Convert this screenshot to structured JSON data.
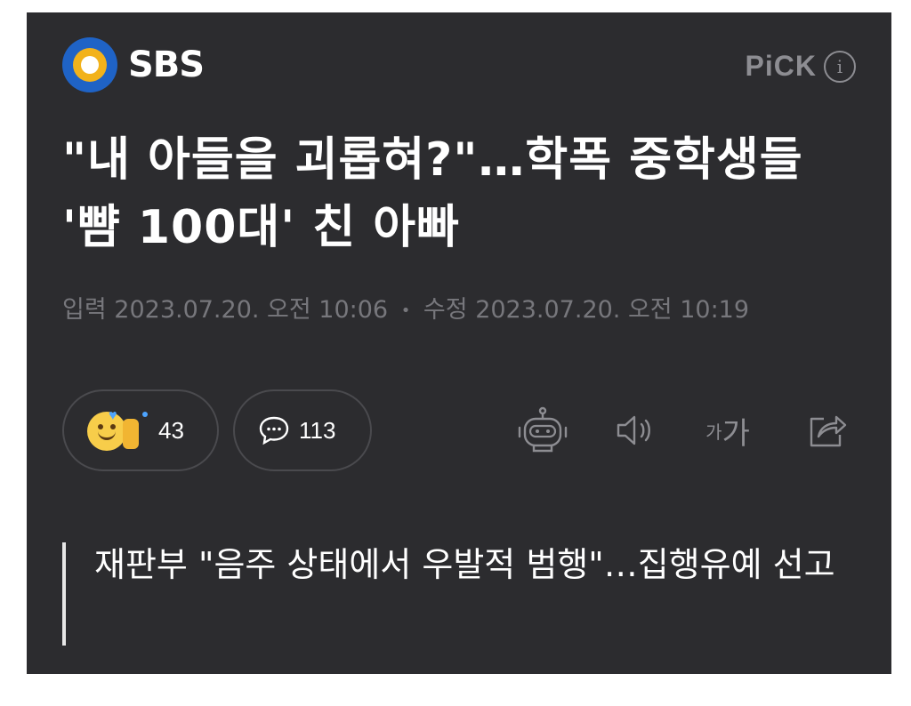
{
  "header": {
    "logo_text": "SBS",
    "pick_label": "PiCK",
    "info_icon": "info-icon"
  },
  "article": {
    "title": "\"내 아들을 괴롭혀?\"…학폭 중학생들 '뺨 100대' 친 아빠",
    "meta": {
      "input_label": "입력",
      "input_time": "2023.07.20. 오전 10:06",
      "separator": "•",
      "edit_label": "수정",
      "edit_time": "2023.07.20. 오전 10:19"
    },
    "subtitle": "재판부 \"음주 상태에서 우발적 범행\"…집행유예 선고"
  },
  "actions": {
    "like_count": "43",
    "comment_count": "113",
    "font_small": "가",
    "font_big": "가"
  },
  "icons": {
    "like": "like-emoji-icon",
    "comment": "comment-bubble-icon",
    "bot": "robot-summary-icon",
    "speaker": "speaker-icon",
    "font": "font-size-icon",
    "share": "share-icon"
  },
  "colors": {
    "card_bg": "#2c2c2f",
    "text": "#ffffff",
    "muted": "#77777c",
    "logo_blue": "#1f63c6",
    "logo_yellow": "#f2b21b"
  }
}
